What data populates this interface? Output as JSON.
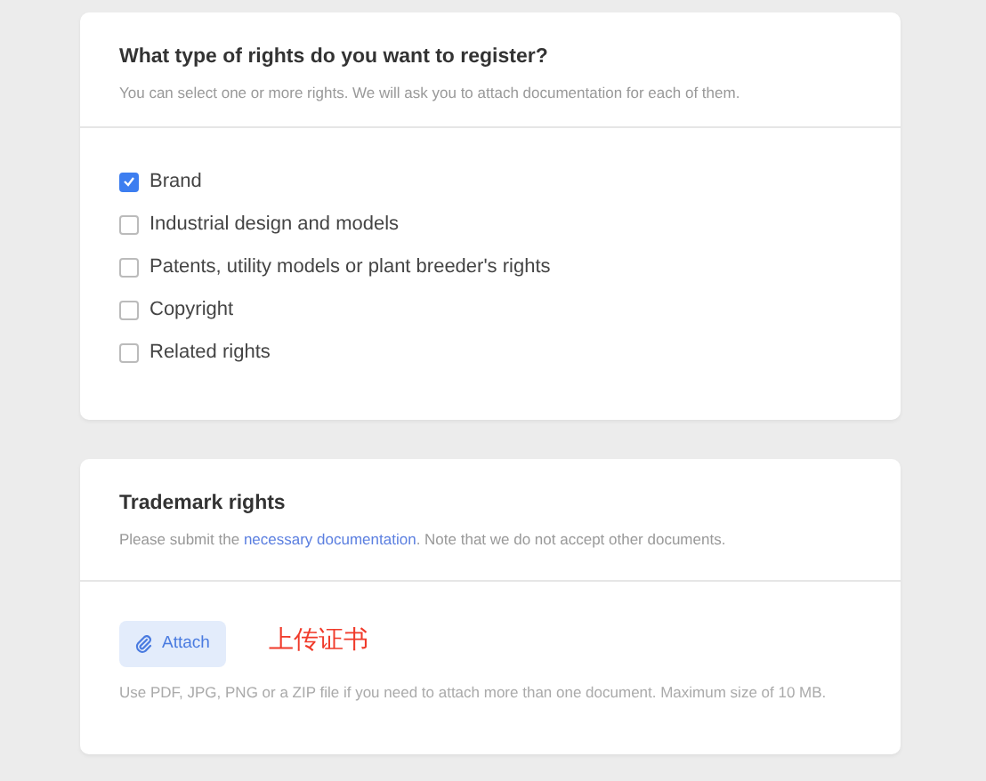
{
  "rights_card": {
    "title": "What type of rights do you want to register?",
    "subtitle": "You can select one or more rights. We will ask you to attach documentation for each of them.",
    "options": [
      {
        "label": "Brand",
        "checked": true
      },
      {
        "label": "Industrial design and models",
        "checked": false
      },
      {
        "label": "Patents, utility models or plant breeder's rights",
        "checked": false
      },
      {
        "label": "Copyright",
        "checked": false
      },
      {
        "label": "Related rights",
        "checked": false
      }
    ]
  },
  "trademark_card": {
    "title": "Trademark rights",
    "note_before": "Please submit the ",
    "note_link": "necessary documentation",
    "note_after": ". Note that we do not accept other documents.",
    "attach_button": "Attach",
    "annotation": "上传证书",
    "hint": "Use PDF, JPG, PNG or a ZIP file if you need to attach more than one document. Maximum size of 10 MB."
  }
}
